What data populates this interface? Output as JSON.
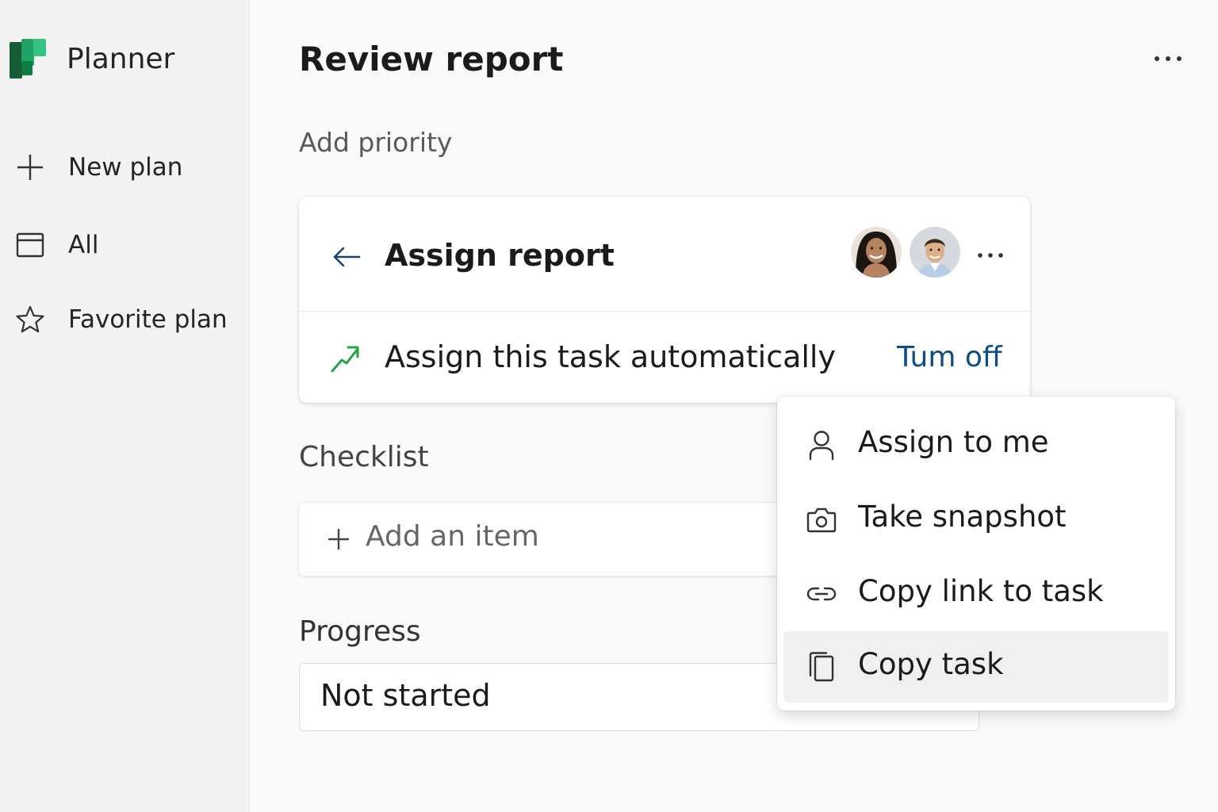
{
  "app": {
    "name": "Planner",
    "brand_colors": {
      "dark": "#185c37",
      "mid": "#21a366",
      "light": "#33c481"
    }
  },
  "sidebar": {
    "items": [
      {
        "label": "New plan",
        "icon": "plus-icon"
      },
      {
        "label": "All",
        "icon": "window-icon"
      },
      {
        "label": "Favorite plan",
        "icon": "star-icon"
      }
    ]
  },
  "task": {
    "title": "Review report",
    "priority_link": "Add priority",
    "more_icon": "more-horizontal-icon"
  },
  "assign_card": {
    "title": "Assign report",
    "assignees": [
      {
        "name": "assignee-avatar-1"
      },
      {
        "name": "assignee-avatar-2"
      }
    ],
    "auto_assign_label": "Assign this task automatically",
    "auto_assign_action": "Tum off",
    "accent_color": "#0f4c8a",
    "trend_color": "#22a447"
  },
  "checklist": {
    "label": "Checklist",
    "add_item_label": "Add an item"
  },
  "progress": {
    "label": "Progress",
    "value": "Not started"
  },
  "context_menu": {
    "items": [
      {
        "label": "Assign to me",
        "icon": "person-icon"
      },
      {
        "label": "Take snapshot",
        "icon": "camera-icon"
      },
      {
        "label": "Copy link to task",
        "icon": "link-icon"
      },
      {
        "label": "Copy task",
        "icon": "copy-icon",
        "highlighted": true
      }
    ]
  }
}
